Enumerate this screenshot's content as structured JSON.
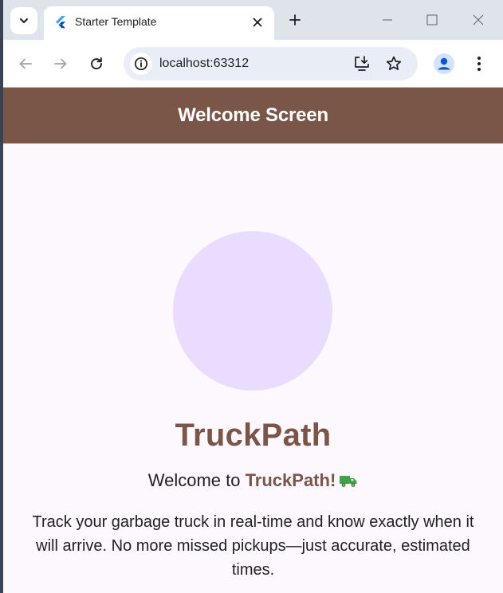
{
  "browser": {
    "tab": {
      "title": "Starter Template"
    },
    "address_bar": {
      "url": "localhost:63312"
    }
  },
  "app": {
    "appbar_title": "Welcome Screen",
    "brand_title": "TruckPath",
    "welcome_prefix": "Welcome to ",
    "welcome_brand": "TruckPath!",
    "description": "Track your garbage truck in real-time and know exactly when it will arrive. No more missed pickups—just accurate, estimated times.",
    "colors": {
      "appbar": "#7a5649",
      "brand": "#7a5649",
      "avatar_circle": "#eadcfe",
      "background": "#fdf7fe",
      "truck_icon": "#43a047"
    }
  },
  "icons": {
    "tab_search": "chevron-down-icon",
    "favicon": "flutter-icon",
    "tab_close": "close-icon",
    "new_tab": "plus-icon",
    "minimize": "minimize-icon",
    "maximize": "maximize-icon",
    "window_close": "close-icon",
    "back": "arrow-left-icon",
    "forward": "arrow-right-icon",
    "reload": "reload-icon",
    "site_info": "info-icon",
    "install": "install-app-icon",
    "bookmark": "star-icon",
    "profile": "profile-icon",
    "menu": "more-vert-icon",
    "truck": "truck-icon"
  }
}
